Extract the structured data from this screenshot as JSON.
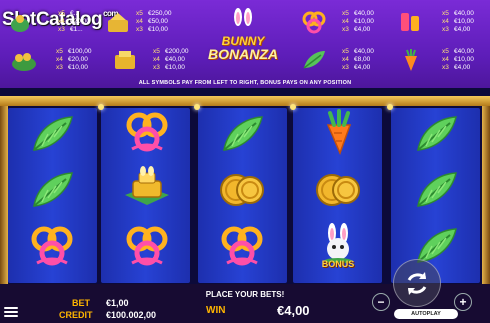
{
  "brand": {
    "part1": "Slot",
    "part2": "Catalog",
    "domain": "com"
  },
  "logo": {
    "line1": "BUNNY",
    "line2": "BONANZA"
  },
  "paytable_info": "ALL SYMBOLS PAY FROM LEFT TO RIGHT, BONUS PAYS ON ANY POSITION",
  "paytable": [
    {
      "symbol": "bunny-bag-icon",
      "rows": [
        [
          "x5",
          "€..."
        ],
        [
          "x4",
          "€20,00"
        ],
        [
          "x3",
          "€1..."
        ]
      ]
    },
    {
      "symbol": "carrot-cake-icon",
      "rows": [
        [
          "x5",
          "€250,00"
        ],
        [
          "x4",
          "€50,00"
        ],
        [
          "x3",
          "€10,00"
        ]
      ]
    },
    {
      "symbol": "bow-icon",
      "rows": [
        [
          "x5",
          "€40,00"
        ],
        [
          "x4",
          "€10,00"
        ],
        [
          "x3",
          "€4,00"
        ]
      ]
    },
    {
      "symbol": "drink-icon",
      "rows": [
        [
          "x5",
          "€40,00"
        ],
        [
          "x4",
          "€10,00"
        ],
        [
          "x3",
          "€4,00"
        ]
      ]
    },
    {
      "symbol": "coins-bowl-icon",
      "rows": [
        [
          "x5",
          "€100,00"
        ],
        [
          "x4",
          "€20,00"
        ],
        [
          "x3",
          "€10,00"
        ]
      ]
    },
    {
      "symbol": "golden-box-icon",
      "rows": [
        [
          "x5",
          "€200,00"
        ],
        [
          "x4",
          "€40,00"
        ],
        [
          "x3",
          "€10,00"
        ]
      ]
    },
    {
      "symbol": "leaf-icon",
      "rows": [
        [
          "x5",
          "€40,00"
        ],
        [
          "x4",
          "€8,00"
        ],
        [
          "x3",
          "€4,00"
        ]
      ]
    },
    {
      "symbol": "carrot-icon",
      "rows": [
        [
          "x5",
          "€40,00"
        ],
        [
          "x4",
          "€10,00"
        ],
        [
          "x3",
          "€4,00"
        ]
      ]
    }
  ],
  "grid": [
    [
      "leaf-icon",
      "bow-icon",
      "leaf-icon",
      "carrot-icon",
      "leaf-icon"
    ],
    [
      "leaf-icon",
      "golden-box-icon",
      "coins-icon",
      "coins-icon",
      "leaf-icon"
    ],
    [
      "bow-icon",
      "bow-icon",
      "bow-icon",
      "bonus-bunny-icon",
      "leaf-icon"
    ]
  ],
  "bonus_label": "BONUS",
  "status": "PLACE YOUR BETS!",
  "bet": {
    "label": "BET",
    "value": "€1,00"
  },
  "credit": {
    "label": "CREDIT",
    "value": "€100.002,00"
  },
  "win": {
    "label": "WIN",
    "value": "€4,00"
  },
  "controls": {
    "minus": "−",
    "plus": "+",
    "autoplay": "AUTOPLAY"
  },
  "colors": {
    "accent": "#ffb500",
    "reel": "#2742d4",
    "top": "#6a22c9"
  }
}
